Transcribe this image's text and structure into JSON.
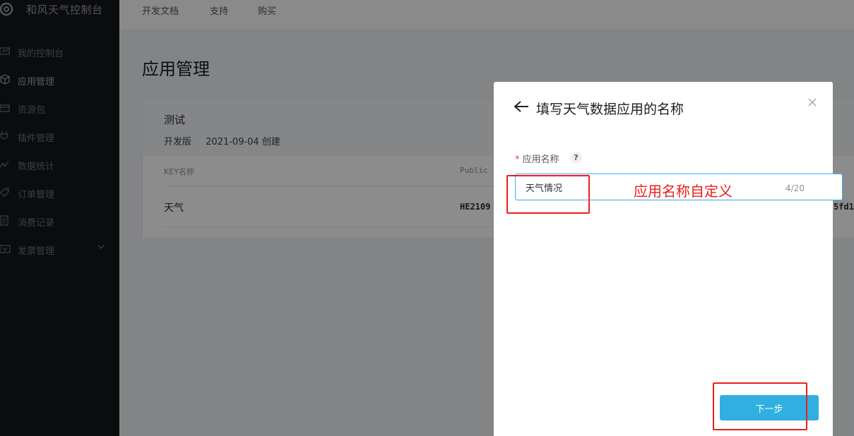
{
  "sidebar": {
    "brand": "和风天气控制台",
    "items": [
      {
        "label": "我的控制台",
        "icon": "monitor-icon"
      },
      {
        "label": "应用管理",
        "icon": "cube-icon"
      },
      {
        "label": "资源包",
        "icon": "package-icon"
      },
      {
        "label": "插件管理",
        "icon": "plugin-icon"
      },
      {
        "label": "数据统计",
        "icon": "chart-icon"
      },
      {
        "label": "订单管理",
        "icon": "tag-icon"
      },
      {
        "label": "消费记录",
        "icon": "document-icon"
      },
      {
        "label": "发票管理",
        "icon": "invoice-icon"
      }
    ]
  },
  "topnav": {
    "links": [
      "开发文档",
      "支持",
      "购买"
    ]
  },
  "page": {
    "title": "应用管理"
  },
  "project": {
    "name": "测试",
    "edition": "开发版",
    "created": "2021-09-04 创建",
    "columns": [
      "KEY名称",
      "Public"
    ],
    "row": {
      "key_name": "天气",
      "public_key_prefix": "HE2109",
      "public_key_tail": "5fd1("
    }
  },
  "modal": {
    "title": "填写天气数据应用的名称",
    "field_label": "应用名称",
    "required_mark": "*",
    "help": "?",
    "input_value": "天气情况",
    "counter": "4/20",
    "next_label": "下一步"
  },
  "annotation": {
    "text": "应用名称自定义",
    "color": "#e8201c"
  },
  "colors": {
    "primary": "#2fb0e0",
    "sidebar_bg": "#14161a",
    "focus_border": "#41a9e8"
  }
}
